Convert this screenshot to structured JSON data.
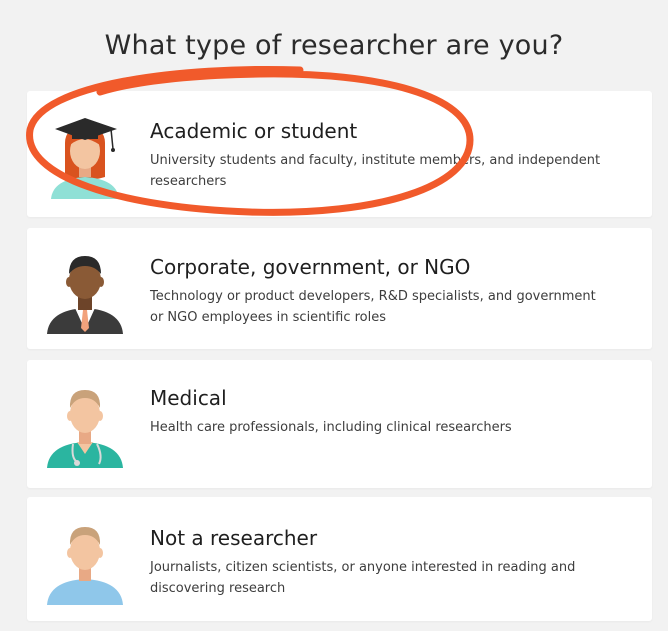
{
  "page": {
    "title": "What type of researcher are you?"
  },
  "options": [
    {
      "title": "Academic or student",
      "description": "University students and faculty, institute members, and independent researchers",
      "avatar": "graduate-avatar-icon"
    },
    {
      "title": "Corporate, government, or NGO",
      "description": "Technology or product developers, R&D specialists, and government or NGO employees in scientific roles",
      "avatar": "business-person-avatar-icon"
    },
    {
      "title": "Medical",
      "description": "Health care professionals, including clinical researchers",
      "avatar": "doctor-avatar-icon"
    },
    {
      "title": "Not a researcher",
      "description": "Journalists, citizen scientists, or anyone interested in reading and discovering research",
      "avatar": "person-avatar-icon"
    }
  ],
  "colors": {
    "background": "#f2f2f2",
    "card": "#ffffff",
    "highlight": "#f15a2b",
    "skin": "#f3c5a1",
    "skin_dark": "#8a5a36",
    "hair_red": "#d9531f",
    "teal": "#2bb5a0",
    "light_blue": "#8fc7ea"
  }
}
